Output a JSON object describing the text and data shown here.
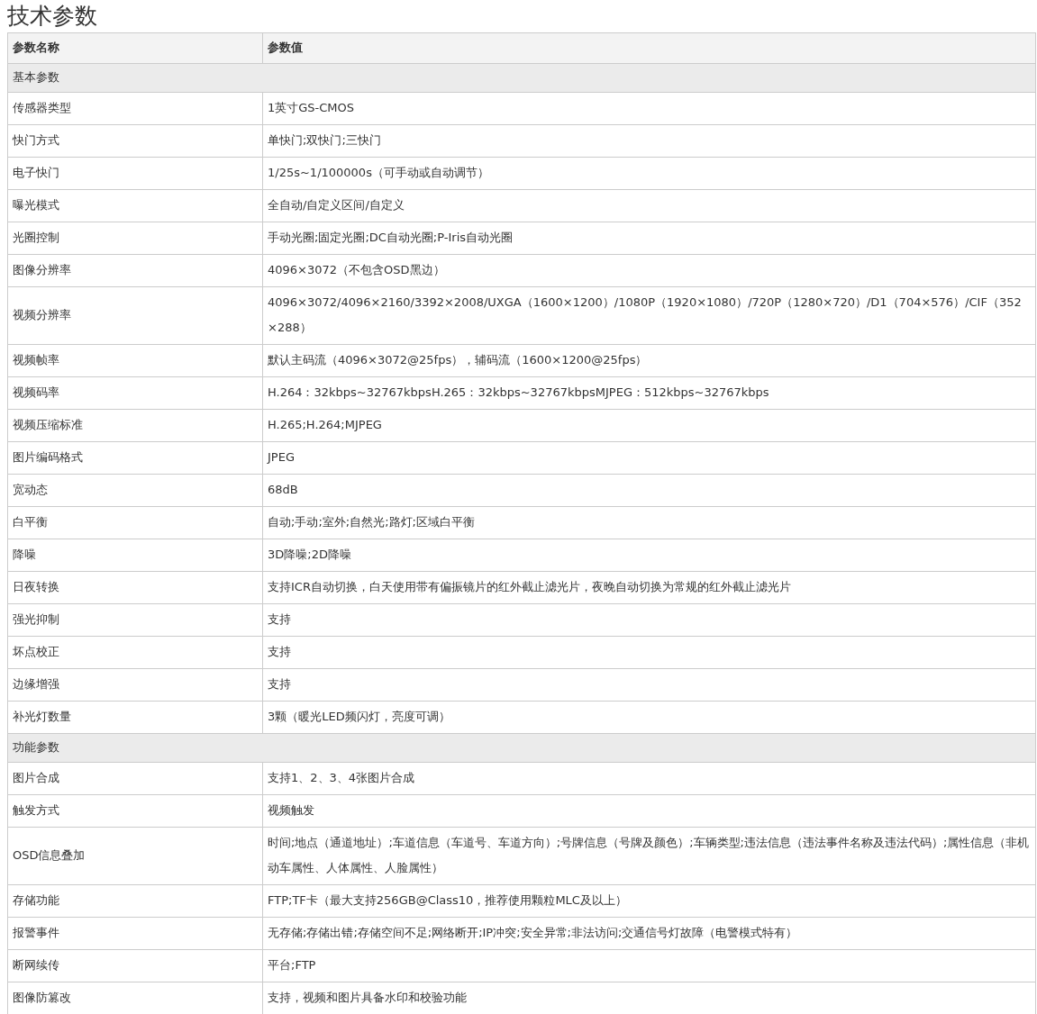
{
  "title": "技术参数",
  "table": {
    "columns": [
      "参数名称",
      "参数值"
    ],
    "sections": [
      {
        "title": "基本参数",
        "rows": [
          {
            "name": "传感器类型",
            "value": "1英寸GS-CMOS"
          },
          {
            "name": "快门方式",
            "value": "单快门;双快门;三快门"
          },
          {
            "name": "电子快门",
            "value": "1/25s~1/100000s（可手动或自动调节）"
          },
          {
            "name": "曝光模式",
            "value": "全自动/自定义区间/自定义"
          },
          {
            "name": "光圈控制",
            "value": "手动光圈;固定光圈;DC自动光圈;P-Iris自动光圈"
          },
          {
            "name": "图像分辨率",
            "value": "4096×3072（不包含OSD黑边）"
          },
          {
            "name": "视频分辨率",
            "value": "4096×3072/4096×2160/3392×2008/UXGA（1600×1200）/1080P（1920×1080）/720P（1280×720）/D1（704×576）/CIF（352×288）"
          },
          {
            "name": "视频帧率",
            "value": "默认主码流（4096×3072@25fps），辅码流（1600×1200@25fps）"
          },
          {
            "name": "视频码率",
            "value": "H.264：32kbps~32767kbpsH.265：32kbps~32767kbpsMJPEG：512kbps~32767kbps"
          },
          {
            "name": "视频压缩标准",
            "value": "H.265;H.264;MJPEG"
          },
          {
            "name": "图片编码格式",
            "value": "JPEG"
          },
          {
            "name": "宽动态",
            "value": "68dB"
          },
          {
            "name": "白平衡",
            "value": "自动;手动;室外;自然光;路灯;区域白平衡"
          },
          {
            "name": "降噪",
            "value": "3D降噪;2D降噪"
          },
          {
            "name": "日夜转换",
            "value": "支持ICR自动切换，白天使用带有偏振镜片的红外截止滤光片，夜晚自动切换为常规的红外截止滤光片"
          },
          {
            "name": "强光抑制",
            "value": "支持"
          },
          {
            "name": "坏点校正",
            "value": "支持"
          },
          {
            "name": "边缘增强",
            "value": "支持"
          },
          {
            "name": "补光灯数量",
            "value": "3颗（暖光LED频闪灯，亮度可调）"
          }
        ]
      },
      {
        "title": "功能参数",
        "rows": [
          {
            "name": "图片合成",
            "value": "支持1、2、3、4张图片合成"
          },
          {
            "name": "触发方式",
            "value": "视频触发"
          },
          {
            "name": "OSD信息叠加",
            "value": "时间;地点（通道地址）;车道信息（车道号、车道方向）;号牌信息（号牌及颜色）;车辆类型;违法信息（违法事件名称及违法代码）;属性信息（非机动车属性、人体属性、人脸属性）"
          },
          {
            "name": "存储功能",
            "value": "FTP;TF卡（最大支持256GB@Class10，推荐使用颗粒MLC及以上）"
          },
          {
            "name": "报警事件",
            "value": "无存储;存储出错;存储空间不足;网络断开;IP冲突;安全异常;非法访问;交通信号灯故障（电警模式特有）"
          },
          {
            "name": "断网续传",
            "value": "平台;FTP"
          },
          {
            "name": "图像防篡改",
            "value": "支持，视频和图片具备水印和校验功能"
          }
        ]
      }
    ]
  }
}
